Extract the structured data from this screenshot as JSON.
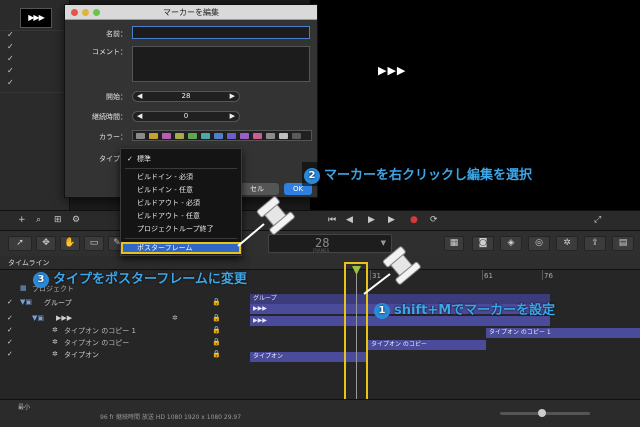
{
  "layers": {
    "thumb_text": "▶▶▶",
    "checks": [
      "✓",
      "✓",
      "✓",
      "✓",
      "✓"
    ]
  },
  "canvas": {
    "title": "▶▶▶"
  },
  "dialog": {
    "title": "マーカーを編集",
    "name_label": "名前：",
    "name_value": "",
    "comment_label": "コメント：",
    "comment_value": "",
    "start_label": "開始：",
    "start_value": "28",
    "duration_label": "継続時間：",
    "duration_value": "0",
    "color_label": "カラー：",
    "type_label": "タイプ：",
    "cancel_label": "セル",
    "ok_label": "OK",
    "colors": [
      "#8a8a8a",
      "#c7a12e",
      "#b45fb4",
      "#a8a84c",
      "#5fa84f",
      "#4fa8a8",
      "#4f7fc7",
      "#6a5fc7",
      "#9a5fc7",
      "#c75f8f",
      "#8c8c8c",
      "#bfbfbf",
      "#5a5a5a"
    ]
  },
  "menu": {
    "items": [
      {
        "label": "標準",
        "checked": true
      },
      {
        "label": "ビルドイン - 必須"
      },
      {
        "label": "ビルドイン - 任意"
      },
      {
        "label": "ビルドアウト - 必須"
      },
      {
        "label": "ビルドアウト - 任意"
      },
      {
        "label": "プロジェクトループ終了"
      },
      {
        "label": "ポスターフレーム",
        "selected": true
      }
    ]
  },
  "toolbar": {
    "fps_value": "28",
    "fps_label": "FRAMES"
  },
  "timeline": {
    "title": "タイムライン",
    "ruler": [
      "31",
      "61",
      "76"
    ],
    "rows": [
      {
        "name": "プロジェクト",
        "indent": 0
      },
      {
        "name": "グループ",
        "indent": 0
      },
      {
        "name": "▶▶▶",
        "indent": 1
      },
      {
        "name": "タイプオン のコピー 1",
        "indent": 2
      },
      {
        "name": "タイプオン のコピー",
        "indent": 2
      },
      {
        "name": "タイプオン",
        "indent": 2
      }
    ],
    "bars": {
      "group": "グループ",
      "arrows1": "▶▶▶",
      "arrows2": "▶▶▶",
      "copy1": "タイプオン のコピー 1",
      "copy": "タイプオン のコピー",
      "typeon": "タイプオン"
    },
    "zoom_label": "最小"
  },
  "status": {
    "text": "96 fr  継続時間 放送 HD 1080 1920 x 1080 29.97"
  },
  "callouts": {
    "c1_num": "1",
    "c1_text": "shift+Mでマーカーを設定",
    "c2_num": "2",
    "c2_text": "マーカーを右クリックし編集を選択",
    "c3_num": "3",
    "c3_text": "タイプをポスターフレームに変更"
  },
  "colors": {
    "accent": "#3da6e8",
    "highlight": "#e8c31a",
    "selection": "#2f66c8"
  }
}
